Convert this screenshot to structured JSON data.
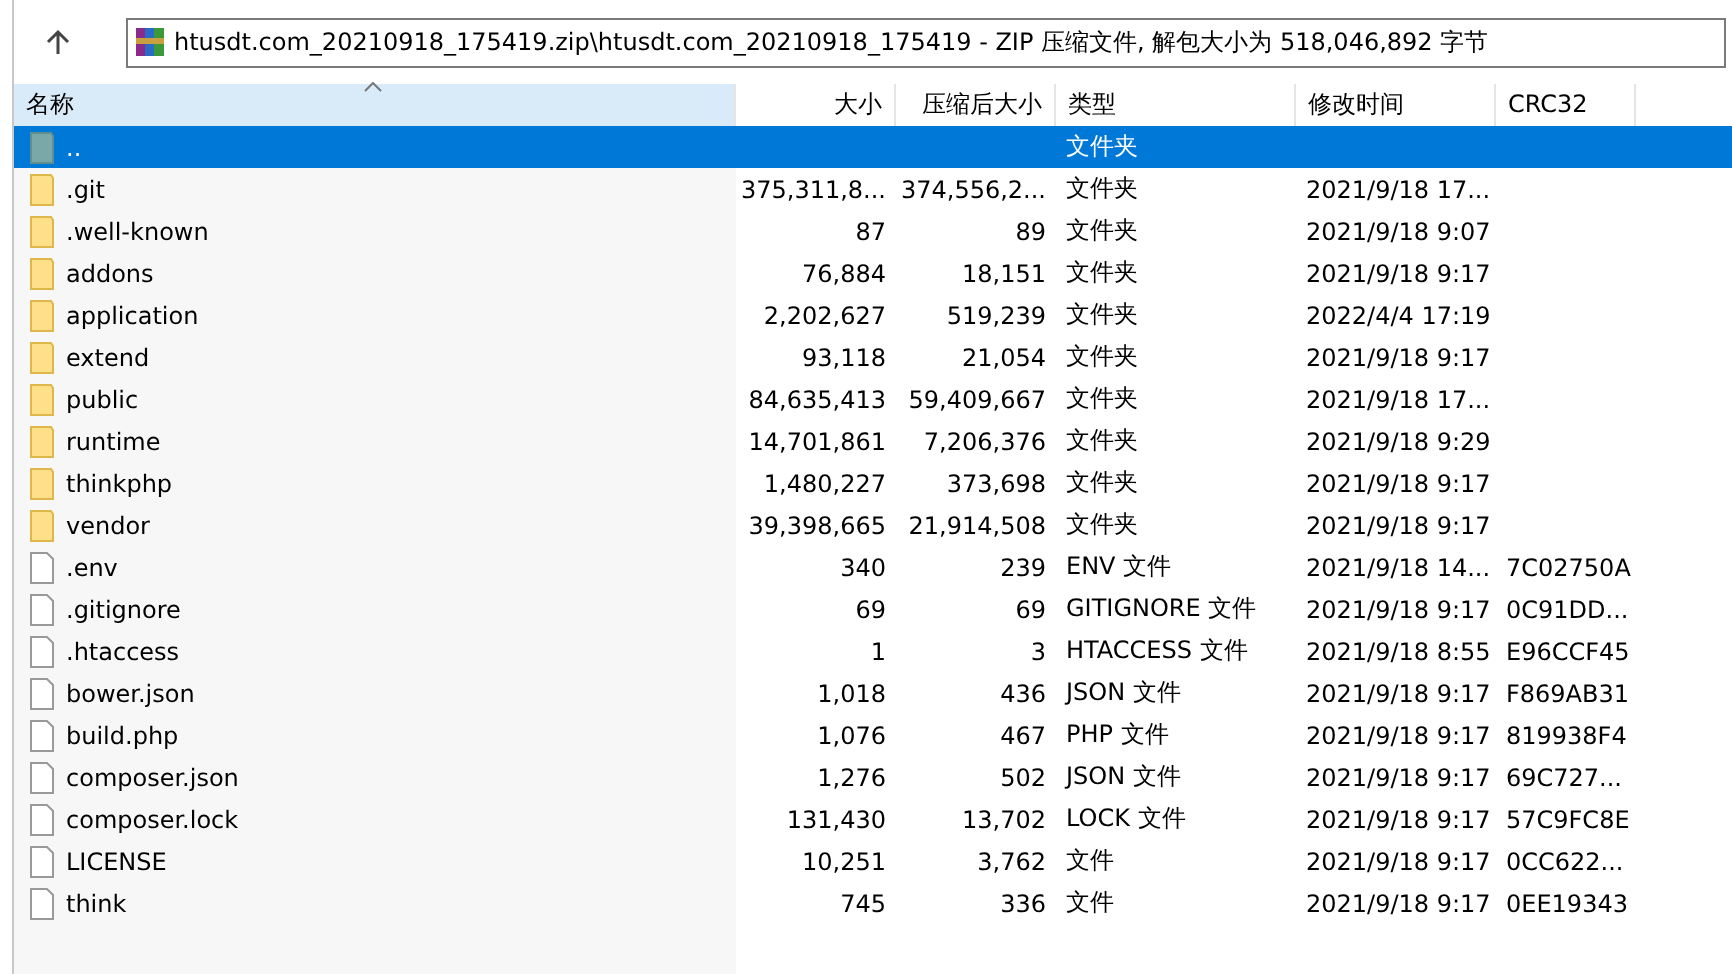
{
  "address": {
    "path": "htusdt.com_20210918_175419.zip\\htusdt.com_20210918_175419 - ZIP 压缩文件, 解包大小为 518,046,892 字节"
  },
  "table": {
    "columns": [
      {
        "label": "名称",
        "sorted": true
      },
      {
        "label": "大小",
        "sorted": false
      },
      {
        "label": "压缩后大小",
        "sorted": false
      },
      {
        "label": "类型",
        "sorted": false
      },
      {
        "label": "修改时间",
        "sorted": false
      },
      {
        "label": "CRC32",
        "sorted": false
      }
    ],
    "rows": [
      {
        "kind": "parent",
        "name": "..",
        "size": "",
        "packed": "",
        "type": "文件夹",
        "modified": "",
        "crc": "",
        "selected": true
      },
      {
        "kind": "folder",
        "name": ".git",
        "size": "375,311,8...",
        "packed": "374,556,2...",
        "type": "文件夹",
        "modified": "2021/9/18 17...",
        "crc": "",
        "selected": false
      },
      {
        "kind": "folder",
        "name": ".well-known",
        "size": "87",
        "packed": "89",
        "type": "文件夹",
        "modified": "2021/9/18 9:07",
        "crc": "",
        "selected": false
      },
      {
        "kind": "folder",
        "name": "addons",
        "size": "76,884",
        "packed": "18,151",
        "type": "文件夹",
        "modified": "2021/9/18 9:17",
        "crc": "",
        "selected": false
      },
      {
        "kind": "folder",
        "name": "application",
        "size": "2,202,627",
        "packed": "519,239",
        "type": "文件夹",
        "modified": "2022/4/4 17:19",
        "crc": "",
        "selected": false
      },
      {
        "kind": "folder",
        "name": "extend",
        "size": "93,118",
        "packed": "21,054",
        "type": "文件夹",
        "modified": "2021/9/18 9:17",
        "crc": "",
        "selected": false
      },
      {
        "kind": "folder",
        "name": "public",
        "size": "84,635,413",
        "packed": "59,409,667",
        "type": "文件夹",
        "modified": "2021/9/18 17...",
        "crc": "",
        "selected": false
      },
      {
        "kind": "folder",
        "name": "runtime",
        "size": "14,701,861",
        "packed": "7,206,376",
        "type": "文件夹",
        "modified": "2021/9/18 9:29",
        "crc": "",
        "selected": false
      },
      {
        "kind": "folder",
        "name": "thinkphp",
        "size": "1,480,227",
        "packed": "373,698",
        "type": "文件夹",
        "modified": "2021/9/18 9:17",
        "crc": "",
        "selected": false
      },
      {
        "kind": "folder",
        "name": "vendor",
        "size": "39,398,665",
        "packed": "21,914,508",
        "type": "文件夹",
        "modified": "2021/9/18 9:17",
        "crc": "",
        "selected": false
      },
      {
        "kind": "file",
        "name": ".env",
        "size": "340",
        "packed": "239",
        "type": "ENV 文件",
        "modified": "2021/9/18 14...",
        "crc": "7C02750A",
        "selected": false
      },
      {
        "kind": "file",
        "name": ".gitignore",
        "size": "69",
        "packed": "69",
        "type": "GITIGNORE 文件",
        "modified": "2021/9/18 9:17",
        "crc": "0C91DD...",
        "selected": false
      },
      {
        "kind": "file",
        "name": ".htaccess",
        "size": "1",
        "packed": "3",
        "type": "HTACCESS 文件",
        "modified": "2021/9/18 8:55",
        "crc": "E96CCF45",
        "selected": false
      },
      {
        "kind": "file",
        "name": "bower.json",
        "size": "1,018",
        "packed": "436",
        "type": "JSON 文件",
        "modified": "2021/9/18 9:17",
        "crc": "F869AB31",
        "selected": false
      },
      {
        "kind": "file",
        "name": "build.php",
        "size": "1,076",
        "packed": "467",
        "type": "PHP 文件",
        "modified": "2021/9/18 9:17",
        "crc": "819938F4",
        "selected": false
      },
      {
        "kind": "file",
        "name": "composer.json",
        "size": "1,276",
        "packed": "502",
        "type": "JSON 文件",
        "modified": "2021/9/18 9:17",
        "crc": "69C727...",
        "selected": false
      },
      {
        "kind": "file",
        "name": "composer.lock",
        "size": "131,430",
        "packed": "13,702",
        "type": "LOCK 文件",
        "modified": "2021/9/18 9:17",
        "crc": "57C9FC8E",
        "selected": false
      },
      {
        "kind": "file",
        "name": "LICENSE",
        "size": "10,251",
        "packed": "3,762",
        "type": "文件",
        "modified": "2021/9/18 9:17",
        "crc": "0CC622...",
        "selected": false
      },
      {
        "kind": "file",
        "name": "think",
        "size": "745",
        "packed": "336",
        "type": "文件",
        "modified": "2021/9/18 9:17",
        "crc": "0EE19343",
        "selected": false
      }
    ]
  }
}
